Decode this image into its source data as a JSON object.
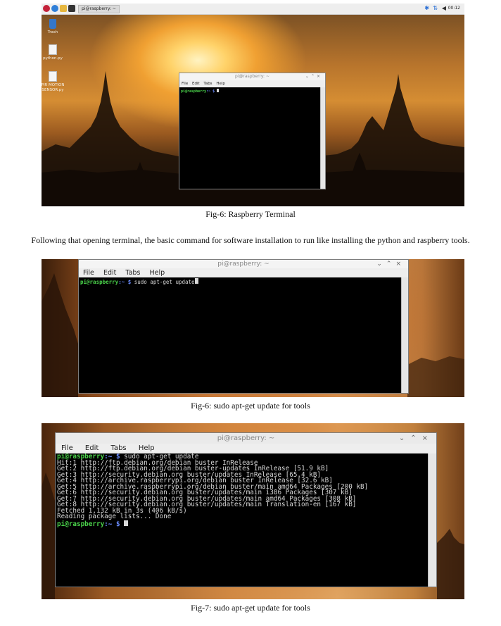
{
  "figures": [
    {
      "caption": "Fig-6: Raspberry Terminal",
      "taskbar": {
        "task_label": "pi@raspberry: ~",
        "clock": "00:12"
      },
      "desktop_icons": [
        {
          "label": "Trash"
        },
        {
          "label": "python.py"
        },
        {
          "label": "PIR MOTION SENSOR.py"
        }
      ],
      "terminal": {
        "title": "pi@raspberry: ~",
        "menu": [
          "File",
          "Edit",
          "Tabs",
          "Help"
        ],
        "prompt_user": "pi@raspberry",
        "prompt_path": ":~ $"
      }
    },
    {
      "caption": "Fig-6: sudo apt-get update for tools",
      "terminal": {
        "title": "pi@raspberry: ~",
        "menu": [
          "File",
          "Edit",
          "Tabs",
          "Help"
        ],
        "prompt_user": "pi@raspberry",
        "prompt_path": ":~ $",
        "command": " sudo apt-get update"
      }
    },
    {
      "caption": "Fig-7: sudo apt-get update for tools",
      "terminal": {
        "title": "pi@raspberry: ~",
        "menu": [
          "File",
          "Edit",
          "Tabs",
          "Help"
        ],
        "prompt_user": "pi@raspberry",
        "prompt_path": ":~ $",
        "command": " sudo apt-get update",
        "output_lines": [
          "Hit:1 http://ftp.debian.org/debian buster InRelease",
          "Get:2 http://ftp.debian.org/debian buster-updates InRelease [51.9 kB]",
          "Get:3 http://security.debian.org buster/updates InRelease [65.4 kB]",
          "Get:4 http://archive.raspberrypi.org/debian buster InRelease [32.6 kB]",
          "Get:5 http://archive.raspberrypi.org/debian buster/main amd64 Packages [200 kB]",
          "Get:6 http://security.debian.org buster/updates/main i386 Packages [307 kB]",
          "Get:7 http://security.debian.org buster/updates/main amd64 Packages [308 kB]",
          "Get:8 http://security.debian.org buster/updates/main Translation-en [167 kB]",
          "Fetched 1,132 kB in 3s (406 kB/s)",
          "Reading package lists... Done"
        ]
      }
    }
  ],
  "paragraph": "Following that opening terminal, the basic command for software installation to run like installing the python and raspberry tools."
}
